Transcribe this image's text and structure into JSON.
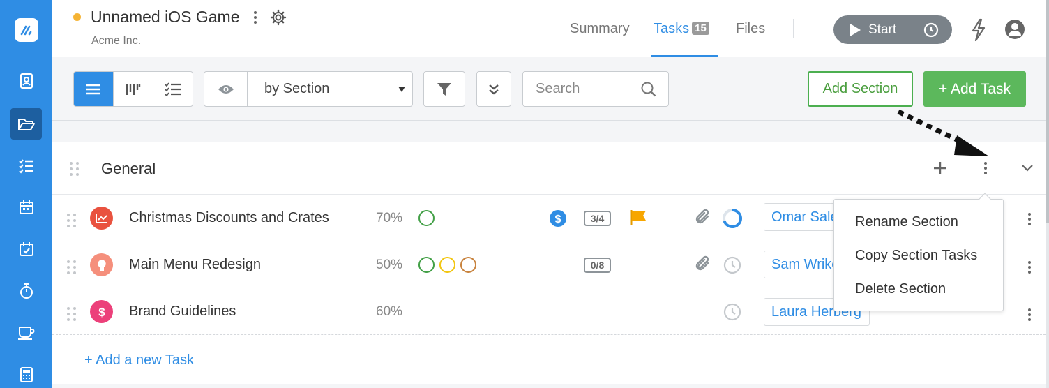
{
  "header": {
    "project_title": "Unnamed iOS Game",
    "company": "Acme Inc.",
    "tabs": [
      {
        "label": "Summary"
      },
      {
        "label": "Tasks",
        "badge": "15"
      },
      {
        "label": "Files"
      }
    ],
    "start_label": "Start"
  },
  "toolbar": {
    "grouping_value": "by Section",
    "search_placeholder": "Search",
    "add_section_label": "Add Section",
    "add_task_label": "+ Add Task"
  },
  "section": {
    "title": "General",
    "add_new_task_label": "+ Add a new Task",
    "tasks": [
      {
        "name": "Christmas Discounts and Crates",
        "percent": "70%",
        "counter": "3/4",
        "assignee": "Omar Saleh",
        "icon_color": "#e9523f"
      },
      {
        "name": "Main Menu Redesign",
        "percent": "50%",
        "counter": "0/8",
        "assignee": "Sam Wrike",
        "icon_color": "#f58f7c"
      },
      {
        "name": "Brand Guidelines",
        "percent": "60%",
        "assignee": "Laura Herberg",
        "icon_color": "#ec407a"
      }
    ]
  },
  "context_menu": {
    "items": [
      {
        "label": "Rename Section"
      },
      {
        "label": "Copy Section Tasks"
      },
      {
        "label": "Delete Section"
      }
    ]
  },
  "colors": {
    "accent": "#2f8de4",
    "success": "#5cb85c",
    "project_dot": "#f5b333",
    "flag": "#f7a600"
  }
}
